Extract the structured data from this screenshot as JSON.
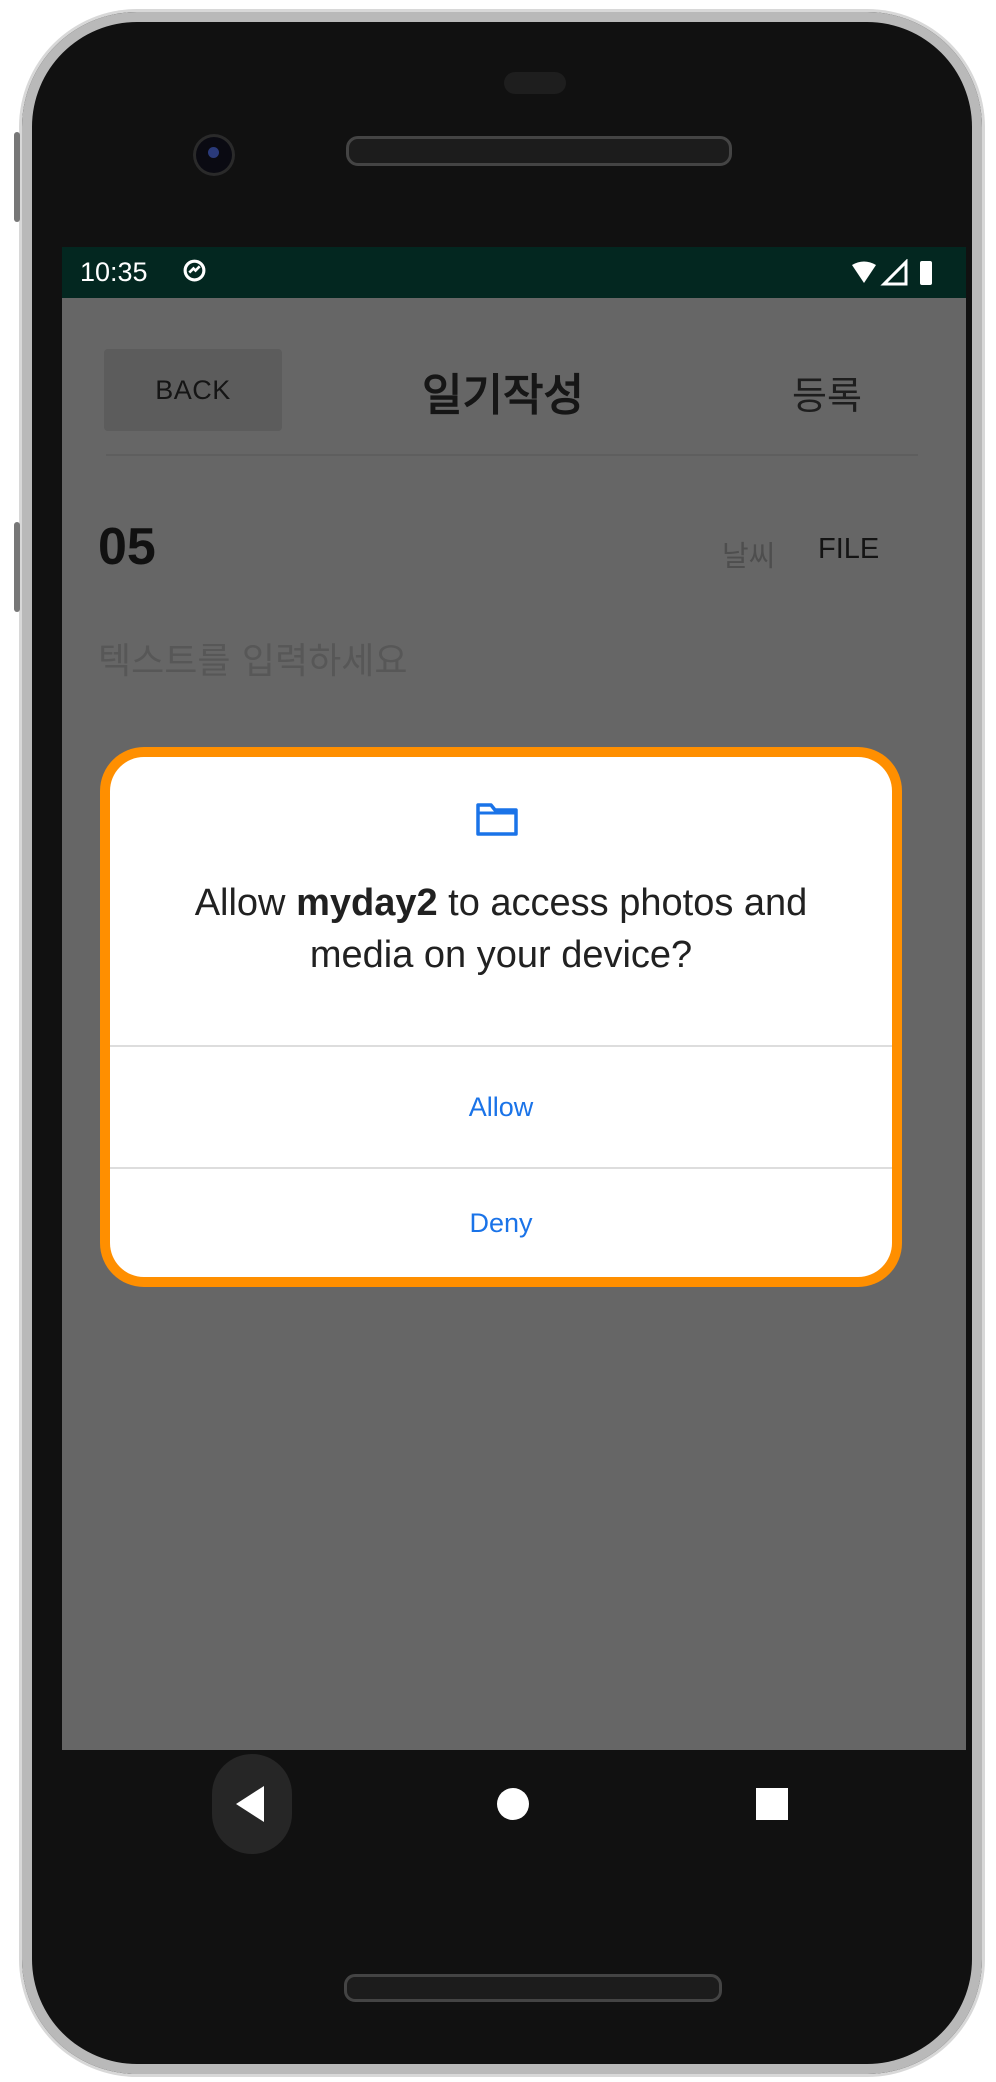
{
  "status_bar": {
    "time": "10:35",
    "sync_icon": "sync-icon",
    "wifi_icon": "wifi-icon",
    "signal_icon": "signal-icon",
    "battery_icon": "battery-icon"
  },
  "app": {
    "back_label": "BACK",
    "title": "일기작성",
    "register_label": "등록",
    "date_day": "05",
    "weather_label": "날씨",
    "file_label": "FILE",
    "text_placeholder": "텍스트를 입력하세요"
  },
  "dialog": {
    "icon": "folder-icon",
    "message_prefix": "Allow ",
    "app_name": "myday2",
    "message_suffix": " to access photos and media on your device?",
    "allow_label": "Allow",
    "deny_label": "Deny"
  },
  "nav": {
    "back_icon": "nav-back-icon",
    "home_icon": "nav-home-icon",
    "recents_icon": "nav-recents-icon"
  },
  "colors": {
    "status_bar": "#032720",
    "dialog_highlight": "#ff8f00",
    "dialog_button_text": "#1a73e8"
  }
}
